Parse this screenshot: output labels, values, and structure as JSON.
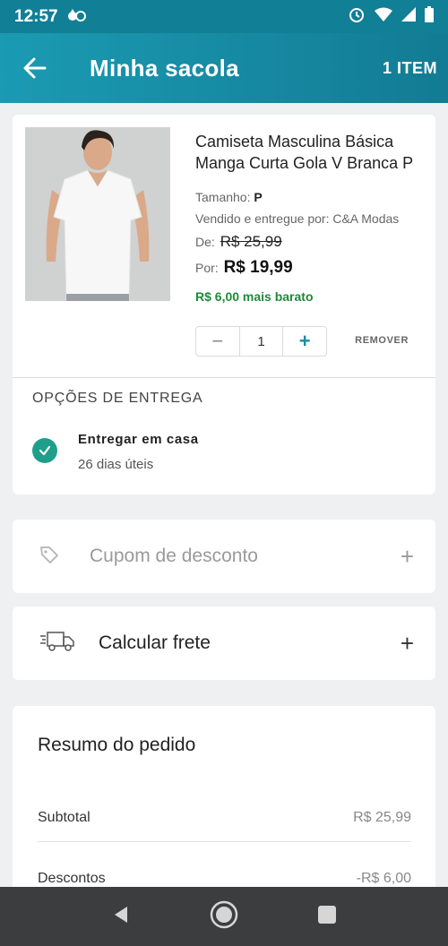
{
  "status_bar": {
    "time": "12:57"
  },
  "header": {
    "title": "Minha sacola",
    "item_count": "1 ITEM"
  },
  "product": {
    "name": "Camiseta Masculina Básica Manga Curta Gola V Branca P",
    "size_label": "Tamanho:",
    "size_value": "P",
    "seller": "Vendido e entregue por: C&A Modas",
    "old_price_label": "De:",
    "old_price": "R$ 25,99",
    "new_price_label": "Por:",
    "new_price": "R$ 19,99",
    "saving": "R$ 6,00 mais barato",
    "quantity": "1",
    "remove_label": "REMOVER"
  },
  "delivery": {
    "section_title": "OPÇÕES DE ENTREGA",
    "option_name": "Entregar em casa",
    "option_time": "26 dias úteis"
  },
  "coupon": {
    "label": "Cupom de desconto",
    "icon": "tag-icon"
  },
  "shipping": {
    "label": "Calcular frete",
    "icon": "truck-icon"
  },
  "summary": {
    "title": "Resumo do pedido",
    "rows": [
      {
        "label": "Subtotal",
        "value": "R$ 25,99"
      },
      {
        "label": "Descontos",
        "value": "-R$ 6,00"
      }
    ]
  },
  "colors": {
    "header": "#1a8ba3",
    "accent": "#1f9f8a",
    "saving": "#1e8a3a"
  }
}
